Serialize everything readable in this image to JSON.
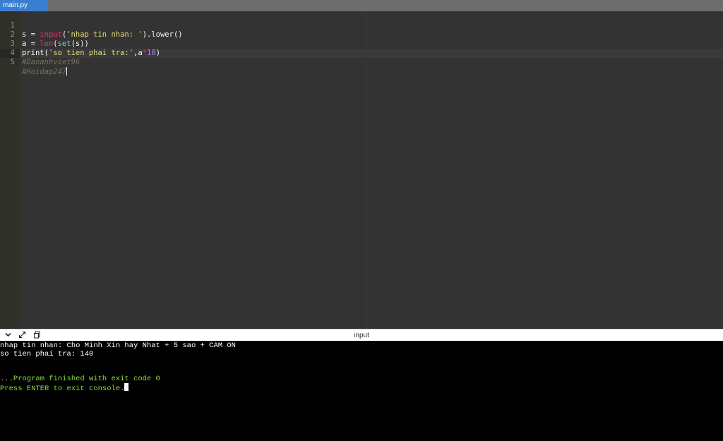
{
  "tabs": [
    {
      "label": "main.py",
      "active": true
    }
  ],
  "editor": {
    "line_numbers": [
      "1",
      "2",
      "3",
      "4",
      "5"
    ],
    "lines": [
      {
        "segments": [
          [
            "s = ",
            "plain"
          ],
          [
            "input",
            "kw"
          ],
          [
            "(",
            "plain"
          ],
          [
            "'nhap tin nhan: '",
            "str"
          ],
          [
            ").lower()",
            "plain"
          ]
        ]
      },
      {
        "segments": [
          [
            "a = ",
            "plain"
          ],
          [
            "len",
            "kw"
          ],
          [
            "(",
            "plain"
          ],
          [
            "set",
            "fn"
          ],
          [
            "(s))",
            "plain"
          ]
        ]
      },
      {
        "segments": [
          [
            "print(",
            "plain"
          ],
          [
            "'so tien phai tra:'",
            "str"
          ],
          [
            ",a",
            "plain"
          ],
          [
            "*",
            "kw"
          ],
          [
            "10",
            "num"
          ],
          [
            ")",
            "plain"
          ]
        ]
      },
      {
        "segments": [
          [
            "#Daoanhviet96",
            "cm"
          ]
        ]
      },
      {
        "segments": [
          [
            "#Hoidap247",
            "cm"
          ]
        ]
      }
    ]
  },
  "console_bar": {
    "title": "input",
    "icons": [
      "chevron-down-icon",
      "expand-icon",
      "copy-icon"
    ]
  },
  "console": {
    "lines": [
      {
        "text": "nhap tin nhan: Cho Minh Xin hay Nhat + 5 sao + CAM ON",
        "color": "white"
      },
      {
        "text": "so tien phai tra: 140",
        "color": "white"
      },
      {
        "text": "",
        "color": "white"
      },
      {
        "text": "",
        "color": "white"
      },
      {
        "text": "...Program finished with exit code 0",
        "color": "green"
      },
      {
        "text": "Press ENTER to exit console.",
        "color": "green"
      }
    ]
  },
  "colors": {
    "tab_active": "#3a7fcf",
    "editor_bg": "#333333",
    "console_bg": "#000000",
    "console_green": "#8ae234"
  }
}
